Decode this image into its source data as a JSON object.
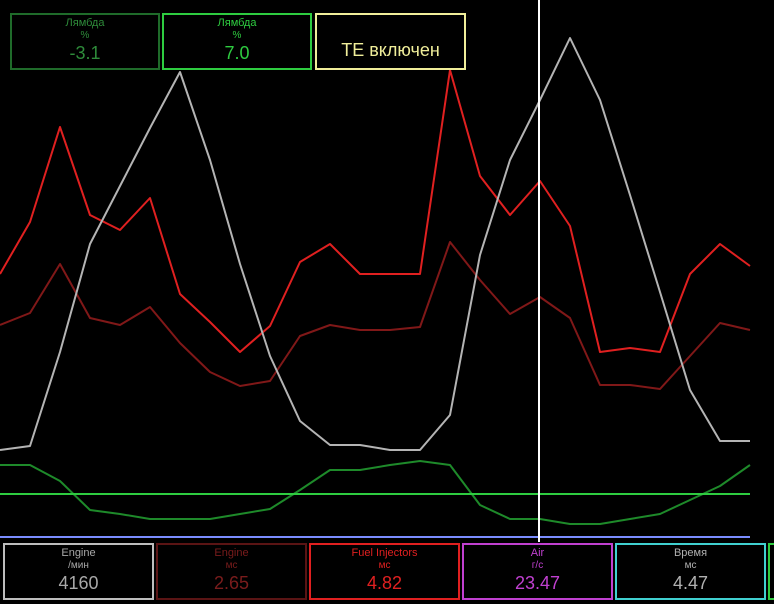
{
  "top_panels": [
    {
      "label": "Лямбда",
      "unit": "%",
      "value": "-3.1",
      "border": "#1f6b2a",
      "text": "#2e8b3a",
      "value_color": "#2e8b3a"
    },
    {
      "label": "Лямбда",
      "unit": "%",
      "value": "7.0",
      "border": "#2ecc40",
      "text": "#2ecc40",
      "value_color": "#2ecc40"
    },
    {
      "status": "ТЕ включен",
      "border": "#f0ee9a",
      "text": "#f0ee9a"
    }
  ],
  "bottom_panels": [
    {
      "label": "Engine",
      "unit": "/мин",
      "value": "4160",
      "border": "#bdbdbd",
      "text": "#a8a8a8",
      "value_color": "#a8a8a8"
    },
    {
      "label": "Engine",
      "unit": "мс",
      "value": "2.65",
      "border": "#5a1414",
      "text": "#7a1c1c",
      "value_color": "#7a1c1c"
    },
    {
      "label": "Fuel Injectors",
      "unit": "мс",
      "value": "4.82",
      "border": "#e02020",
      "text": "#e02020",
      "value_color": "#e02020"
    },
    {
      "label": "Air",
      "unit": "г/с",
      "value": "23.47",
      "border": "#c040d0",
      "text": "#c040d0",
      "value_color": "#c040d0"
    },
    {
      "label": "Время",
      "unit": "мс",
      "value": "4.47",
      "border": "#40d0d0",
      "text": "#b0b0b0",
      "value_color": "#b0b0b0"
    }
  ],
  "chart_data": {
    "type": "line",
    "grid": false,
    "series": [
      {
        "color": "#e02020",
        "values": [
          274,
          222,
          127,
          215,
          230,
          198,
          294,
          322,
          352,
          326,
          262,
          244,
          274,
          274,
          274,
          70,
          176,
          215,
          181,
          226,
          352,
          348,
          352,
          274,
          244,
          266
        ]
      },
      {
        "color": "#801818",
        "values": [
          325,
          313,
          264,
          318,
          325,
          307,
          343,
          372,
          386,
          381,
          336,
          325,
          330,
          330,
          327,
          242,
          280,
          314,
          297,
          318,
          385,
          385,
          389,
          356,
          323,
          330
        ]
      },
      {
        "color": "#b4b4b4",
        "values": [
          450,
          446,
          352,
          244,
          186,
          128,
          72,
          160,
          264,
          356,
          421,
          445,
          445,
          450,
          450,
          415,
          255,
          160,
          100,
          38,
          100,
          195,
          292,
          390,
          441,
          441
        ]
      },
      {
        "color": "#1e8a2a",
        "values": [
          465,
          465,
          481,
          510,
          514,
          519,
          519,
          519,
          514,
          509,
          490,
          470,
          470,
          465,
          461,
          465,
          505,
          519,
          519,
          524,
          524,
          519,
          514,
          500,
          486,
          465
        ]
      },
      {
        "color": "#2ecc40",
        "values": [
          494,
          494
        ]
      },
      {
        "color": "#7a8cff",
        "values": [
          537,
          537
        ]
      }
    ],
    "cursor": {
      "color": "#ffffff"
    }
  }
}
